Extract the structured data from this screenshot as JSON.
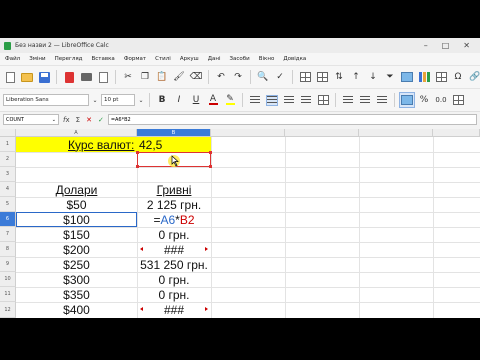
{
  "window": {
    "title": "Без назви 2 — LibreOffice Calc"
  },
  "menu": [
    "Файл",
    "Зміни",
    "Перегляд",
    "Вставка",
    "Формат",
    "Стилі",
    "Аркуш",
    "Дані",
    "Засоби",
    "Вікно",
    "Довідка"
  ],
  "format_bar": {
    "font_name": "Liberation Sans",
    "font_size": "10 pt"
  },
  "formula_bar": {
    "name_box": "COUNT",
    "formula": "=A6*B2"
  },
  "columns": [
    "A",
    "B"
  ],
  "rows": [
    "1",
    "2",
    "3",
    "4",
    "5",
    "6",
    "7",
    "8",
    "9",
    "10",
    "11",
    "12"
  ],
  "cells": {
    "a1": "Курс валют:",
    "b1": "42,5",
    "a4": "Долари",
    "b4": "Гривні",
    "a5": "$50",
    "b5": "2 125 грн.",
    "a6": "$100",
    "b6_eq": "=",
    "b6_ref_a": "A6",
    "b6_op": "*",
    "b6_ref_b": "B2",
    "a7": "$150",
    "b7": "0 грн.",
    "a8": "$200",
    "b8": "###",
    "a9": "$250",
    "b9": "531 250 грн.",
    "a10": "$300",
    "b10": "0 грн.",
    "a11": "$350",
    "b11": "0 грн.",
    "a12": "$400",
    "b12": "###"
  },
  "colors": {
    "highlight": "#ffff00",
    "selection": "#2a68c8",
    "reference_b": "#d33333",
    "accent_header": "#3b7bd8"
  }
}
